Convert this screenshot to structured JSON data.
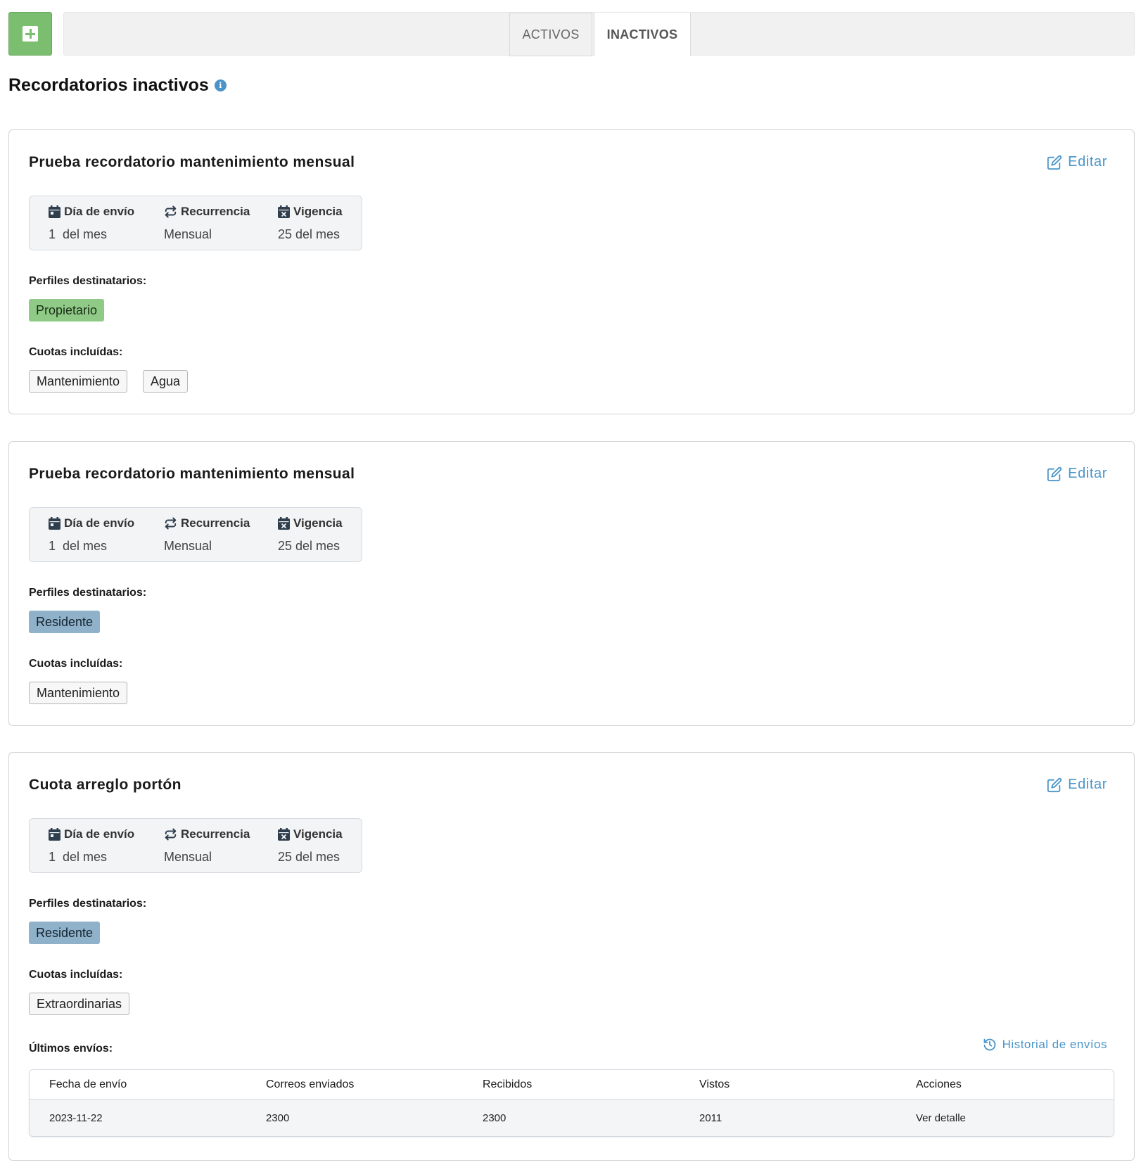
{
  "toolbar": {
    "add_icon": "plus-square-icon"
  },
  "tabs": [
    {
      "label": "ACTIVOS",
      "active": false
    },
    {
      "label": "INACTIVOS",
      "active": true
    }
  ],
  "page": {
    "title": "Recordatorios inactivos",
    "info_icon": "info-circle-icon"
  },
  "labels": {
    "edit": "Editar",
    "dia_envio": "Día de envío",
    "recurrencia": "Recurrencia",
    "vigencia": "Vigencia",
    "perfiles": "Perfiles destinatarios:",
    "cuotas": "Cuotas incluídas:",
    "ultimos_envios": "Últimos envíos:",
    "historial": "Historial de envíos"
  },
  "colors": {
    "accent": "#4a96c9",
    "add_button": "#7cbe70",
    "chip_propietario": "#8fcb86",
    "chip_residente": "#8fb1c9"
  },
  "reminders": [
    {
      "title": "Prueba recordatorio mantenimiento mensual",
      "dia_envio_num": "1",
      "dia_envio_suffix": "del mes",
      "recurrencia": "Mensual",
      "vigencia": "25 del mes",
      "perfiles": [
        "Propietario"
      ],
      "cuotas": [
        "Mantenimiento",
        "Agua"
      ]
    },
    {
      "title": "Prueba recordatorio mantenimiento mensual",
      "dia_envio_num": "1",
      "dia_envio_suffix": "del mes",
      "recurrencia": "Mensual",
      "vigencia": "25 del mes",
      "perfiles": [
        "Residente"
      ],
      "cuotas": [
        "Mantenimiento"
      ]
    },
    {
      "title": "Cuota arreglo portón",
      "dia_envio_num": "1",
      "dia_envio_suffix": "del mes",
      "recurrencia": "Mensual",
      "vigencia": "25 del mes",
      "perfiles": [
        "Residente"
      ],
      "cuotas": [
        "Extraordinarias"
      ],
      "envios": {
        "columns": [
          "Fecha de envío",
          "Correos enviados",
          "Recibidos",
          "Vistos",
          "Acciones"
        ],
        "rows": [
          {
            "fecha": "2023-11-22",
            "enviados": "2300",
            "recibidos": "2300",
            "vistos": "2011",
            "accion": "Ver detalle"
          }
        ]
      }
    }
  ]
}
